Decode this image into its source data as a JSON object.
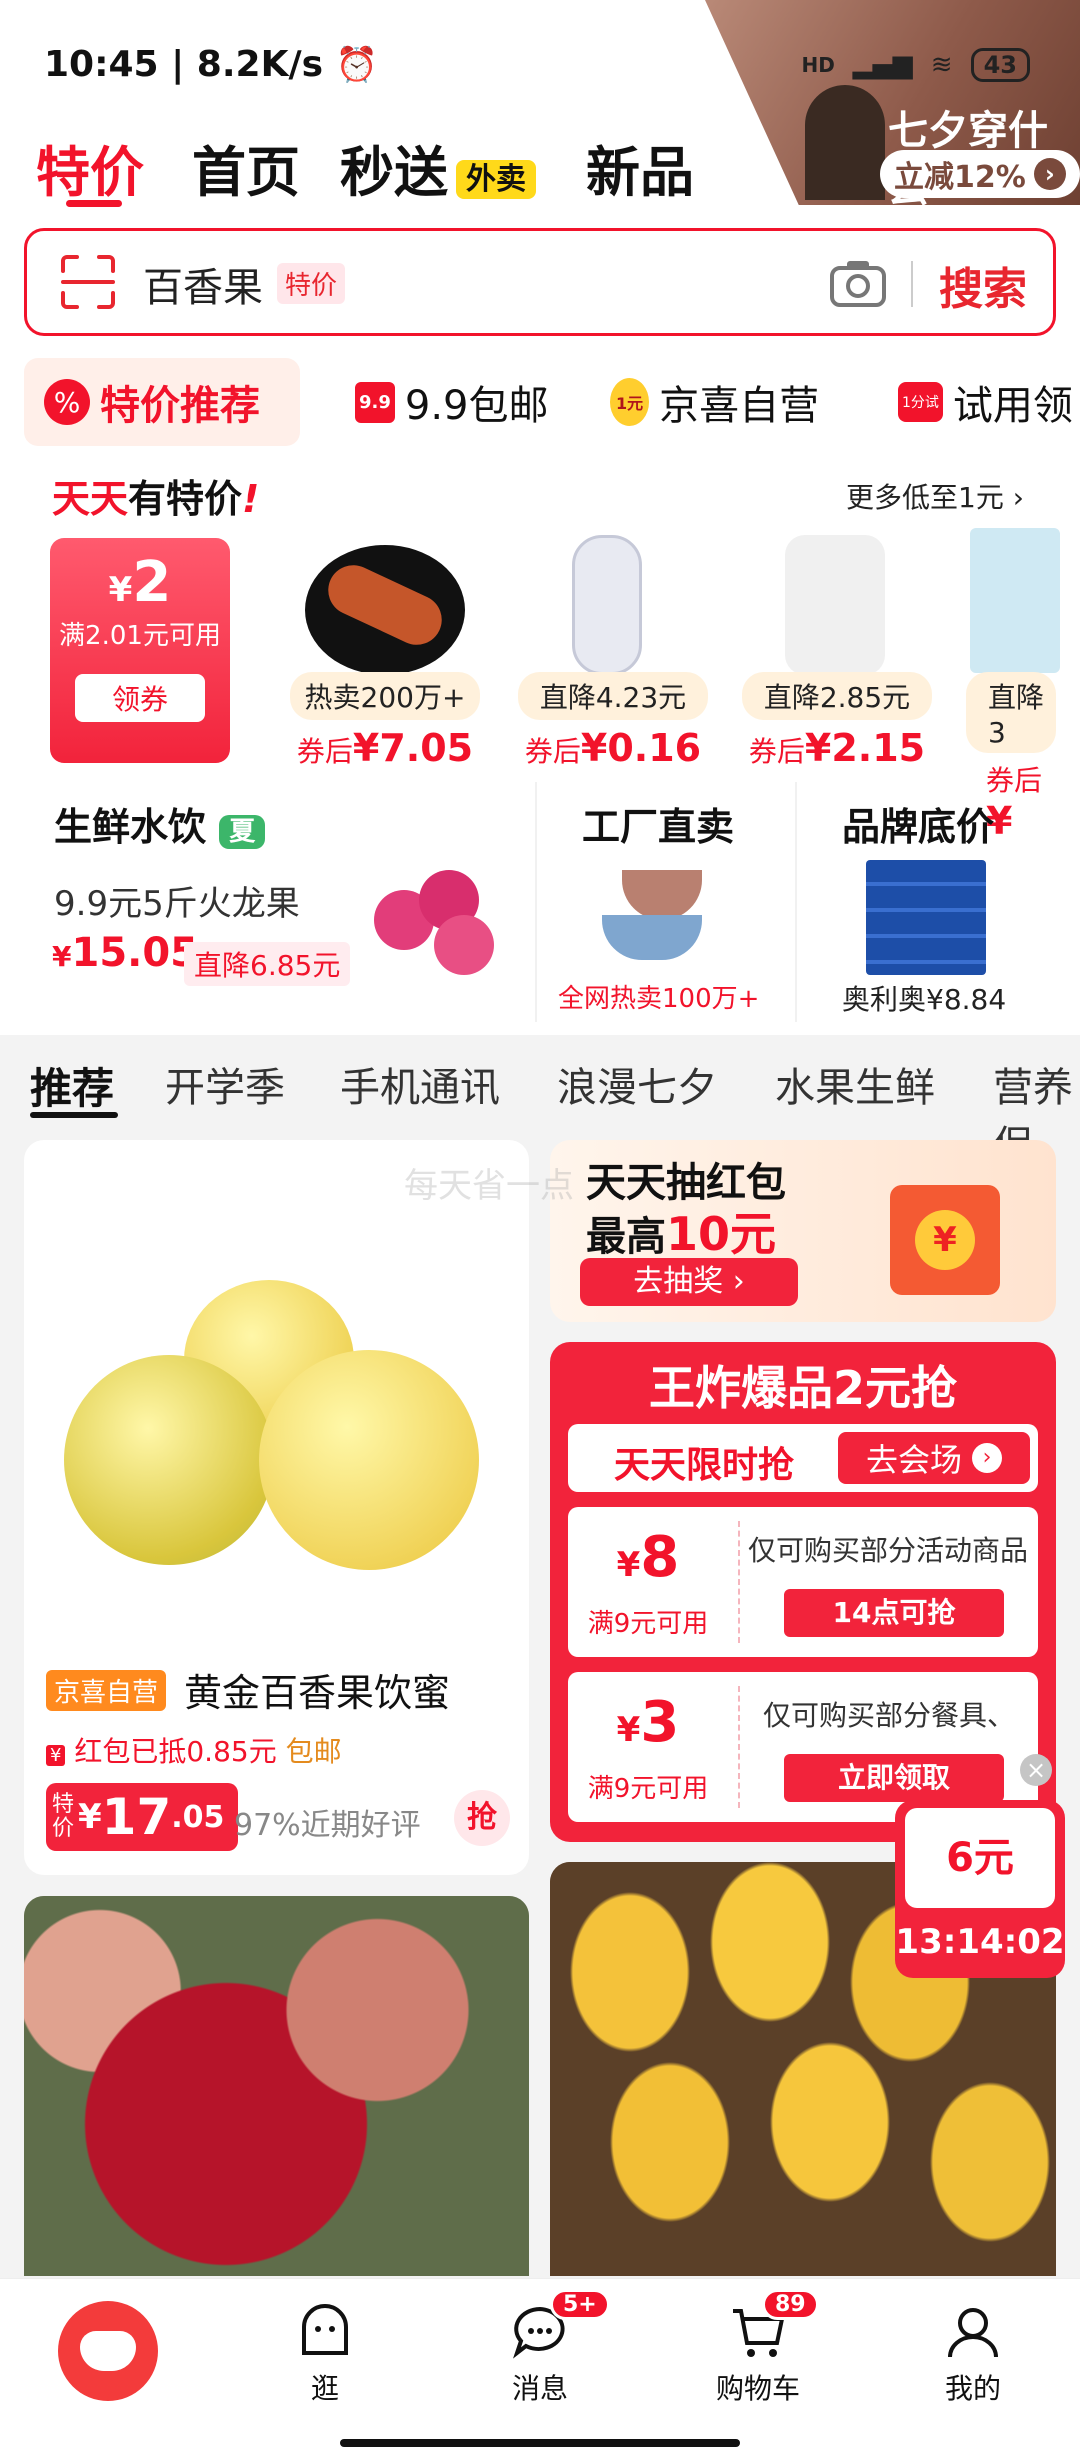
{
  "status": {
    "time": "10:45 | 8.2K/s",
    "net": "HD",
    "battery": "43"
  },
  "promo": {
    "title": "七夕穿什么",
    "discount": "立减12%"
  },
  "nav": {
    "tabs": [
      "特价",
      "首页",
      "秒送",
      "新品"
    ],
    "waimai": "外卖"
  },
  "search": {
    "placeholder": "百香果",
    "tag": "特价",
    "button": "搜索"
  },
  "chips": [
    "特价推荐",
    "9.9包邮",
    "京喜自营",
    "试用领"
  ],
  "chip_badges": {
    "c2": "9.9",
    "c3": "1元",
    "c4": "1分试"
  },
  "daily": {
    "title_a": "天天",
    "title_b": "有特价",
    "more": "更多低至1元",
    "coupon": {
      "amount": "2",
      "cond": "满2.01元可用",
      "button": "领券"
    },
    "items": [
      {
        "pill": "热卖200万+",
        "after": "券后",
        "price": "7.05"
      },
      {
        "pill": "直降4.23元",
        "after": "券后",
        "price": "0.16"
      },
      {
        "pill": "直降2.85元",
        "after": "券后",
        "price": "2.15"
      },
      {
        "pill": "直降3",
        "after": "券后",
        "price": "¥"
      }
    ]
  },
  "fresh": {
    "title": "生鲜水饮",
    "tag": "夏",
    "desc": "9.9元5斤火龙果",
    "price": "15.05",
    "drop": "直降6.85元"
  },
  "factory": {
    "title": "工厂直卖",
    "desc": "全网热卖100万+"
  },
  "brand": {
    "title": "品牌底价",
    "desc": "奥利奥¥8.84"
  },
  "subtabs": [
    "推荐",
    "开学季",
    "手机通讯",
    "浪漫七夕",
    "水果生鲜",
    "营养保"
  ],
  "product1": {
    "tag": "京喜自营",
    "name": "黄金百香果饮蜜",
    "redpack": "红包已抵0.85元",
    "ship": "包邮",
    "special": "特价",
    "price_int": "17",
    "price_dec": ".05",
    "rating": "97%近期好评",
    "grab": "抢"
  },
  "lottery": {
    "watermark": "每天省一点",
    "line1": "天天抽红包",
    "line2a": "最高",
    "line2b": "10元",
    "button": "去抽奖"
  },
  "flash": {
    "title": "王炸爆品2元抢",
    "sub": "天天限时抢",
    "go": "去会场",
    "c1": {
      "amount": "8",
      "cond": "满9元可用",
      "desc": "仅可购买部分活动商品",
      "btn": "14点可抢"
    },
    "c2": {
      "amount": "3",
      "cond": "满9元可用",
      "desc": "仅可购买部分餐具、",
      "btn": "立即领取"
    }
  },
  "floating": {
    "amount": "6元",
    "timer": "13:14:02"
  },
  "bottom": {
    "items": [
      "逛",
      "消息",
      "购物车",
      "我的"
    ],
    "msg_badge": "5+",
    "cart_badge": "89"
  },
  "colors": {
    "accent": "#f2132b"
  }
}
